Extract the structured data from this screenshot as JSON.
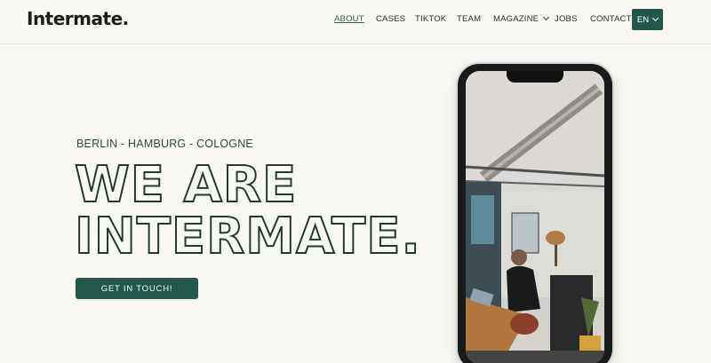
{
  "brand": {
    "name": "Intermate."
  },
  "nav": {
    "items": [
      {
        "label": "ABOUT",
        "active": true
      },
      {
        "label": "CASES",
        "active": false
      },
      {
        "label": "TIKTOK",
        "active": false
      },
      {
        "label": "TEAM",
        "active": false
      },
      {
        "label": "MAGAZINE",
        "active": false,
        "dropdown": true
      },
      {
        "label": "JOBS",
        "active": false
      },
      {
        "label": "CONTACT",
        "active": false
      }
    ],
    "language": "EN"
  },
  "hero": {
    "subtitle": "BERLIN - HAMBURG - COLOGNE",
    "headline_line1": "WE ARE",
    "headline_line2": "INTERMATE.",
    "cta_label": "GET IN TOUCH!"
  },
  "colors": {
    "background": "#faf8f3",
    "accent": "#22574b",
    "text_dark": "#1f3a34"
  }
}
